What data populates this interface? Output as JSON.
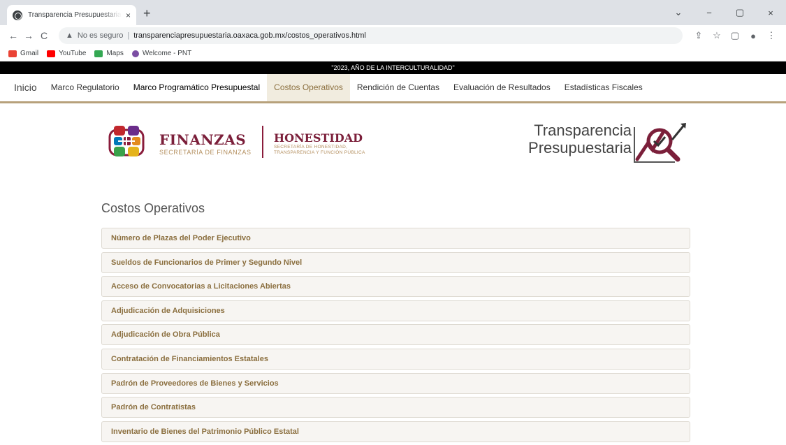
{
  "browser": {
    "tab_title": "Transparencia Presupuestaria - C",
    "tab_close": "×",
    "new_tab": "+",
    "window_controls": [
      "⌄",
      "−",
      "▢",
      "×"
    ],
    "nav": {
      "back": "←",
      "forward": "→",
      "reload": "C"
    },
    "address": {
      "warning_icon": "▲",
      "not_secure_label": "No es seguro",
      "separator": "|",
      "url": "transparenciapresupuestaria.oaxaca.gob.mx/costos_operativos.html"
    },
    "toolbar_icons": [
      "⇪",
      "☆",
      "▢",
      "●",
      "⋮"
    ],
    "bookmarks": [
      {
        "label": "Gmail",
        "color": "#ea4335"
      },
      {
        "label": "YouTube",
        "color": "#ff0000"
      },
      {
        "label": "Maps",
        "color": "#34a853"
      },
      {
        "label": "Welcome - PNT",
        "color": "#7b4ea3"
      }
    ]
  },
  "page": {
    "banner": "\"2023, AÑO DE LA INTERCULTURALIDAD\"",
    "menu": [
      "Inicio",
      "Marco Regulatorio",
      "Marco Programático Presupuestal",
      "Costos Operativos",
      "Rendición de Cuentas",
      "Evaluación de Resultados",
      "Estadísticas Fiscales"
    ],
    "logos": {
      "finanzas_title": "FINANZAS",
      "finanzas_sub": "SECRETARÍA DE FINANZAS",
      "honestidad_title": "HONESTIDAD",
      "honestidad_sub1": "SECRETARÍA DE HONESTIDAD,",
      "honestidad_sub2": "TRANSPARENCIA Y FUNCIÓN PÚBLICA",
      "tp_word1": "Transparencia",
      "tp_word2": "Presupuestaria"
    },
    "section_title": "Costos Operativos",
    "items": [
      "Número de Plazas del Poder Ejecutivo",
      "Sueldos de Funcionarios de Primer y Segundo Nivel",
      "Acceso de Convocatorias a Licitaciones Abiertas",
      "Adjudicación de Adquisiciones",
      "Adjudicación de Obra Pública",
      "Contratación de Financiamientos Estatales",
      "Padrón de Proveedores de Bienes y Servicios",
      "Padrón de Contratistas",
      "Inventario de Bienes del Patrimonio Público Estatal"
    ],
    "colors": {
      "accent_gold": "#8b6f3f",
      "brand_maroon": "#7b1f3a",
      "menu_underline": "#b7a17b"
    }
  }
}
